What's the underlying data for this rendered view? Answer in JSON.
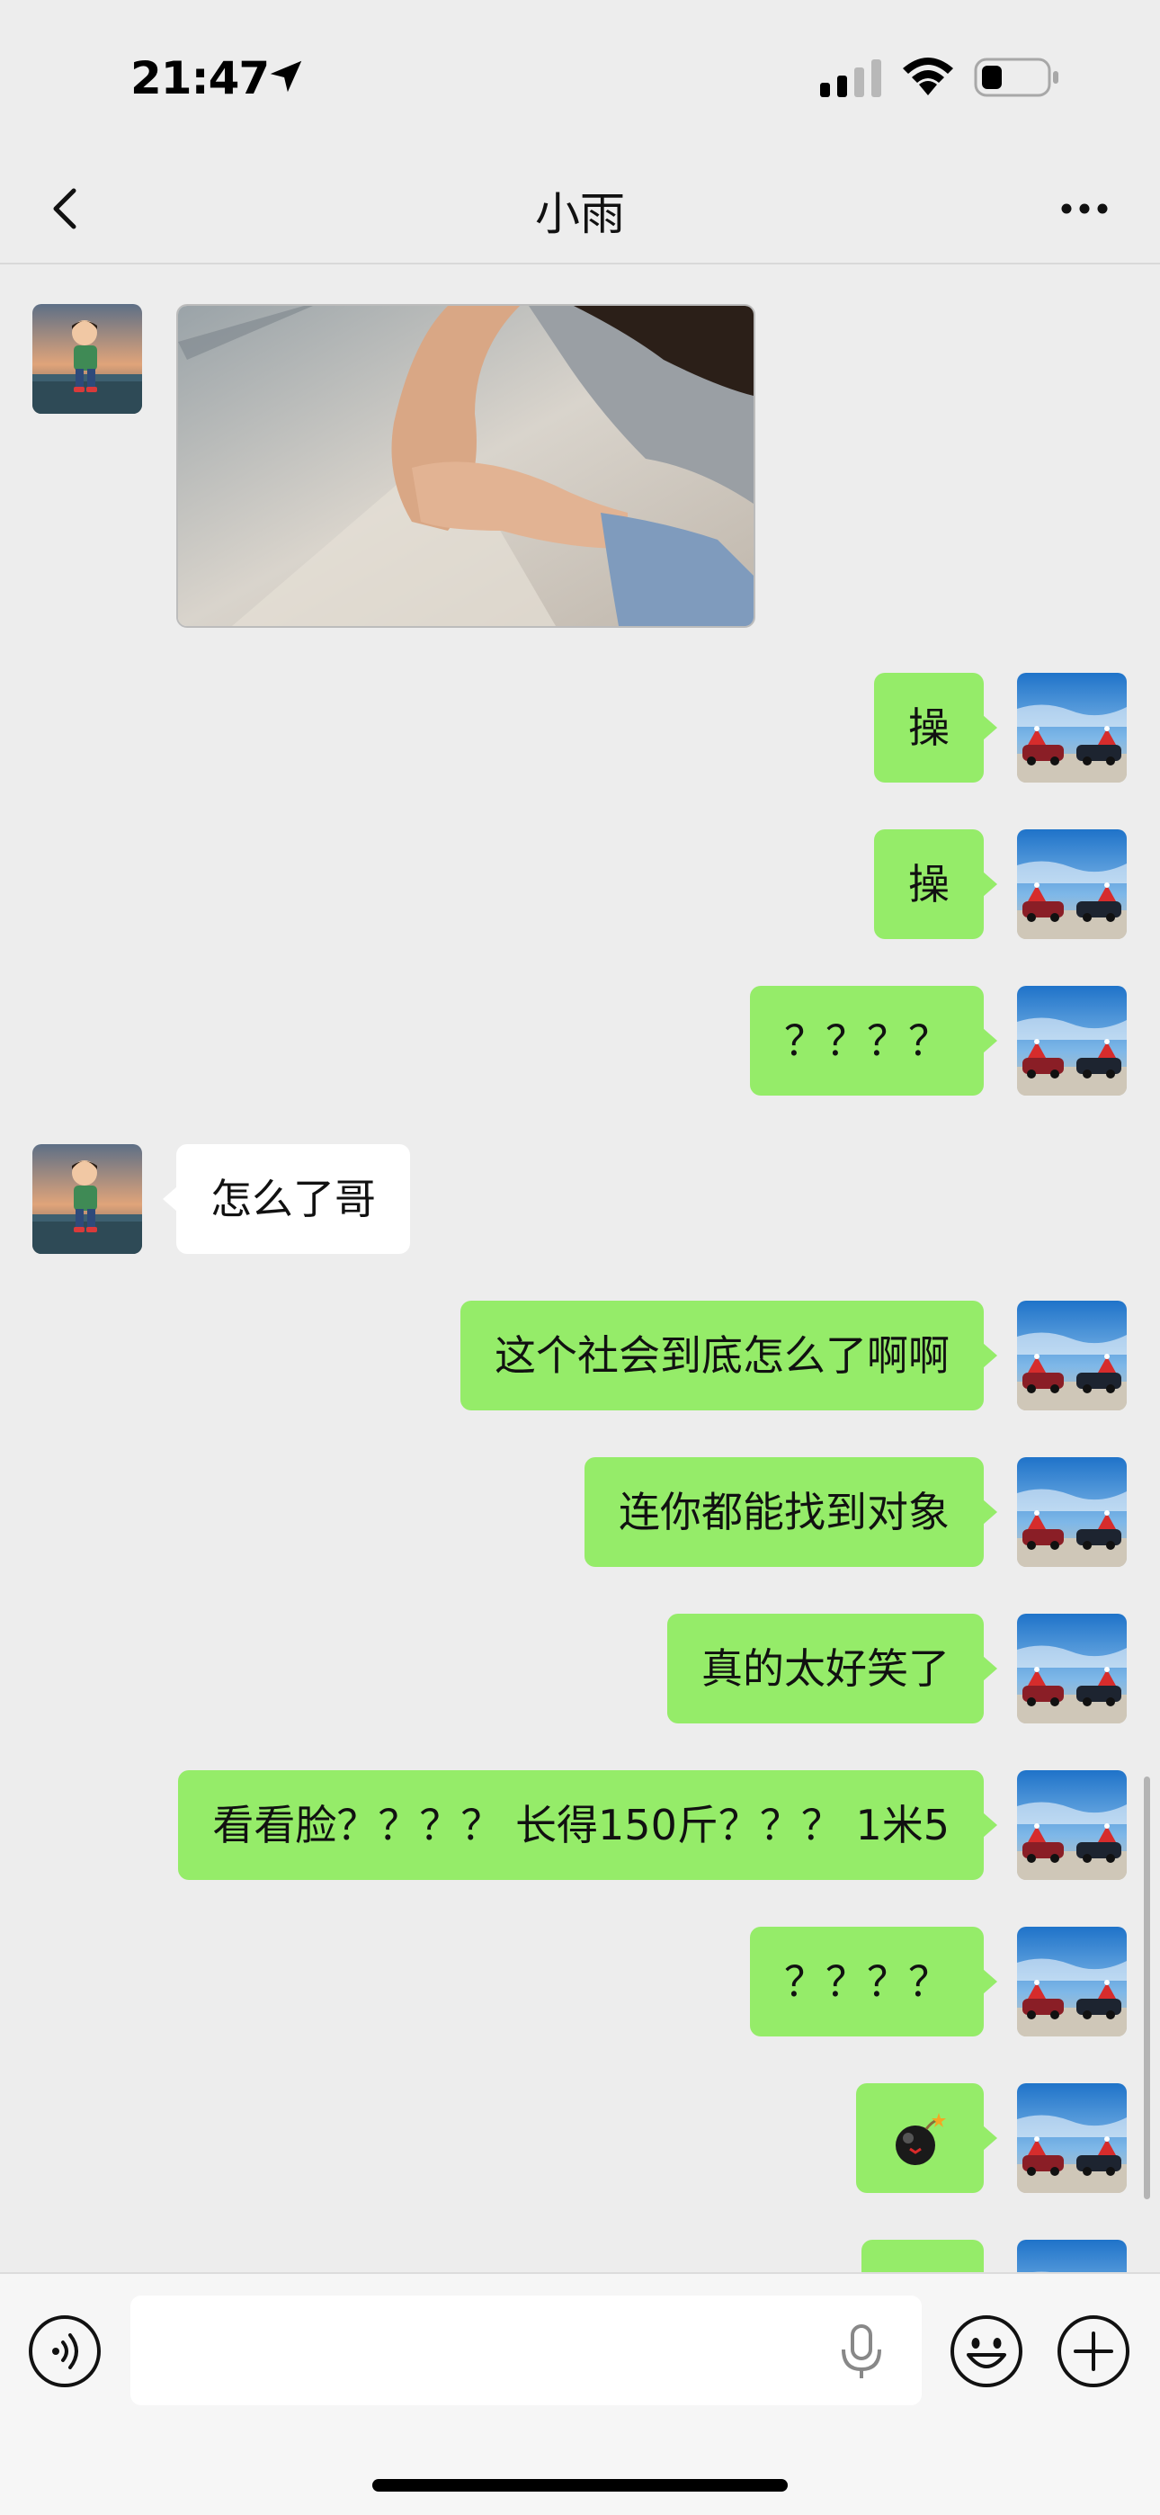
{
  "status_bar": {
    "time": "21:47",
    "icons": [
      "location-arrow-icon",
      "signal-icon",
      "wifi-icon",
      "battery-icon"
    ]
  },
  "nav": {
    "title": "小雨",
    "back_icon": "chevron-left-icon",
    "more_icon": "more-dots-icon"
  },
  "messages": [
    {
      "side": "left",
      "type": "image",
      "content": "photo of two holding hands"
    },
    {
      "side": "right",
      "type": "text",
      "text": "操"
    },
    {
      "side": "right",
      "type": "text",
      "text": "操"
    },
    {
      "side": "right",
      "type": "text",
      "text": "？？？？"
    },
    {
      "side": "left",
      "type": "text",
      "text": "怎么了哥"
    },
    {
      "side": "right",
      "type": "text",
      "text": "这个社会到底怎么了啊啊"
    },
    {
      "side": "right",
      "type": "text",
      "text": "连你都能找到对象"
    },
    {
      "side": "right",
      "type": "text",
      "text": "真的太好笑了"
    },
    {
      "side": "right",
      "type": "text",
      "text": "看看脸？？？？ 长得150斤？？？ 1米5"
    },
    {
      "side": "right",
      "type": "text",
      "text": "？？？？"
    },
    {
      "side": "right",
      "type": "emoji",
      "icon": "bomb-icon"
    }
  ],
  "input_bar": {
    "voice_icon": "voice-icon",
    "mic_icon": "microphone-icon",
    "emoji_icon": "smiley-icon",
    "plus_icon": "plus-icon",
    "placeholder": ""
  },
  "colors": {
    "background": "#ededed",
    "sent_bubble": "#95ec69",
    "received_bubble": "#ffffff"
  }
}
